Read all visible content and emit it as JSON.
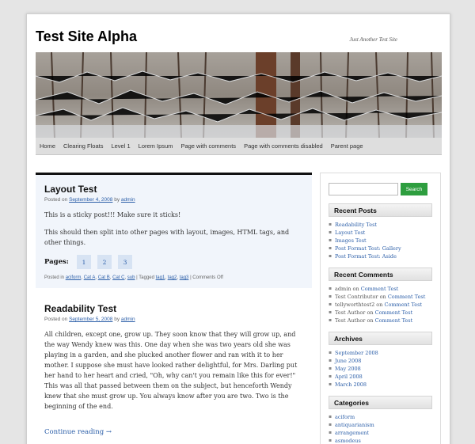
{
  "site": {
    "title": "Test Site Alpha",
    "tagline": "Just Another Test Site"
  },
  "nav": [
    "Home",
    "Clearing Floats",
    "Level 1",
    "Lorem Ipsum",
    "Page with comments",
    "Page with comments disabled",
    "Parent page"
  ],
  "posts": [
    {
      "title": "Layout Test",
      "meta": {
        "prefix": "Posted on",
        "date": "September 4, 2008",
        "by": "by",
        "author": "admin"
      },
      "paragraphs": [
        "This is a sticky post!!! Make sure it sticks!",
        "This should then split into other pages with layout, images, HTML tags, and other things."
      ],
      "pages_label": "Pages:",
      "pages": [
        "1",
        "2",
        "3"
      ],
      "footer": {
        "posted_in": "Posted in",
        "cats": [
          "aciform",
          "Cat A",
          "Cat B",
          "Cat C",
          "sub"
        ],
        "tagged": "| Tagged",
        "tags": [
          "tag1",
          "tag2",
          "tag3"
        ],
        "comments": "| Comments Off"
      }
    },
    {
      "title": "Readability Test",
      "meta": {
        "prefix": "Posted on",
        "date": "September 5, 2008",
        "by": "by",
        "author": "admin"
      },
      "paragraphs": [
        "All children, except one, grow up. They soon know that they will grow up, and the way Wendy knew was this. One day when she was two years old she was playing in a garden, and she plucked another flower and ran with it to her mother. I suppose she must have looked rather delightful, for Mrs. Darling put her hand to her heart and cried, \"Oh, why can't you remain like this for ever!\" This was all that passed between them on the subject, but henceforth Wendy knew that she must grow up. You always know after you are two. Two is the beginning of the end."
      ],
      "continue": "Continue reading →"
    }
  ],
  "sidebar": {
    "search_button": "Search",
    "recent_posts": {
      "title": "Recent Posts",
      "items": [
        "Readability Test",
        "Layout Test",
        "Images Test",
        "Post Format Test: Gallery",
        "Post Format Test: Aside"
      ]
    },
    "recent_comments": {
      "title": "Recent Comments",
      "items": [
        {
          "author": "admin",
          "on": "on",
          "post": "Comment Test"
        },
        {
          "author": "Test Contributor",
          "on": "on",
          "post": "Comment Test"
        },
        {
          "author": "tellyworthtest2",
          "on": "on",
          "post": "Comment Test"
        },
        {
          "author": "Test Author",
          "on": "on",
          "post": "Comment Test"
        },
        {
          "author": "Test Author",
          "on": "on",
          "post": "Comment Test"
        }
      ]
    },
    "archives": {
      "title": "Archives",
      "items": [
        "September 2008",
        "June 2008",
        "May 2008",
        "April 2008",
        "March 2008"
      ]
    },
    "categories": {
      "title": "Categories",
      "items": [
        "aciform",
        "antiquarianism",
        "arrangement",
        "asmodeus"
      ]
    }
  },
  "colors": {
    "link": "#2b5ea8",
    "search_button": "#2e9e3f",
    "sticky_bg": "#f1f5fb"
  }
}
